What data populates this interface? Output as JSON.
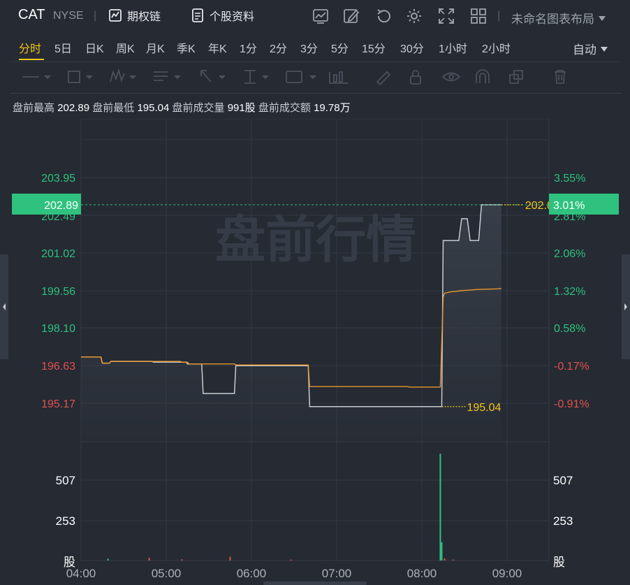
{
  "header": {
    "ticker": "CAT",
    "exchange": "NYSE",
    "options_chain": "期权链",
    "stock_profile": "个股资料",
    "layout_name": "未命名图表布局"
  },
  "periods": [
    {
      "label": "分时",
      "active": true
    },
    {
      "label": "5日"
    },
    {
      "label": "日K"
    },
    {
      "label": "周K"
    },
    {
      "label": "月K"
    },
    {
      "label": "季K"
    },
    {
      "label": "年K"
    },
    {
      "label": "1分"
    },
    {
      "label": "2分"
    },
    {
      "label": "3分"
    },
    {
      "label": "5分"
    },
    {
      "label": "15分"
    },
    {
      "label": "30分"
    },
    {
      "label": "1小时"
    },
    {
      "label": "2小时"
    }
  ],
  "scale_mode": "自动",
  "info": {
    "high_label": "盘前最高",
    "high": "202.89",
    "low_label": "盘前最低",
    "low": "195.04",
    "vol_label": "盘前成交量",
    "vol": "991股",
    "amt_label": "盘前成交额",
    "amt": "19.78万"
  },
  "watermark": "盘前行情",
  "colors": {
    "up": "#2ec27e",
    "down": "#e2514d",
    "price_line": "#c8ccd2",
    "avg_line": "#e8962e",
    "highlight": "#f5c518"
  },
  "chart_data": {
    "type": "line",
    "y_price_ticks": [
      "203.95",
      "201.02",
      "199.56",
      "198.10",
      "196.63",
      "195.17"
    ],
    "y_pct_ticks": [
      "3.55%",
      "2.06%",
      "1.32%",
      "0.58%",
      "-0.17%",
      "-0.91%"
    ],
    "partial_price_tick": "202.49",
    "partial_pct_tick": "2.81%",
    "current_price": "202.89",
    "current_pct": "3.01%",
    "high_marker": "202.89",
    "low_marker": "195.04",
    "prev_close": 196.97,
    "ylim": [
      194.0,
      205.0
    ],
    "x_ticks": [
      "04:00",
      "05:00",
      "06:00",
      "07:00",
      "08:00",
      "09:00"
    ],
    "xlim_minutes": [
      0,
      330
    ],
    "price_series": {
      "x": [
        0,
        14,
        15,
        20,
        21,
        50,
        51,
        70,
        71,
        74,
        75,
        85,
        86,
        108,
        109,
        160,
        161,
        230,
        231,
        254,
        255,
        258,
        266,
        268,
        272,
        274,
        276,
        280,
        282,
        293,
        294,
        295,
        296
      ],
      "y": [
        196.97,
        196.97,
        196.73,
        196.73,
        196.8,
        196.8,
        196.77,
        196.77,
        196.77,
        196.77,
        196.7,
        196.7,
        195.55,
        195.55,
        196.63,
        196.63,
        195.04,
        195.04,
        195.04,
        195.04,
        201.5,
        201.5,
        201.5,
        202.35,
        202.35,
        201.5,
        201.5,
        201.5,
        202.89,
        202.89,
        202.89,
        202.89,
        202.89
      ]
    },
    "avg_series": {
      "x": [
        0,
        14,
        15,
        20,
        21,
        70,
        71,
        75,
        76,
        108,
        109,
        160,
        161,
        230,
        231,
        253,
        255,
        256,
        260,
        268,
        280,
        293,
        294,
        296
      ],
      "y": [
        196.97,
        196.97,
        196.73,
        196.73,
        196.8,
        196.8,
        196.77,
        196.77,
        196.7,
        196.7,
        196.66,
        196.66,
        195.82,
        195.82,
        195.8,
        195.8,
        199.3,
        199.45,
        199.5,
        199.55,
        199.6,
        199.62,
        199.63,
        199.63
      ]
    },
    "volume": {
      "unit": "股",
      "ticks": [
        "507",
        "253"
      ],
      "ylim": [
        0,
        760
      ],
      "bars": [
        {
          "x": 19,
          "v": 12,
          "up": true
        },
        {
          "x": 48,
          "v": 18,
          "up": false
        },
        {
          "x": 71,
          "v": 8,
          "up": false
        },
        {
          "x": 105,
          "v": 25,
          "up": false
        },
        {
          "x": 148,
          "v": 6,
          "up": false
        },
        {
          "x": 253,
          "v": 700,
          "up": true
        },
        {
          "x": 254,
          "v": 120,
          "up": true
        },
        {
          "x": 256,
          "v": 14,
          "up": false
        },
        {
          "x": 262,
          "v": 6,
          "up": false
        }
      ]
    }
  }
}
